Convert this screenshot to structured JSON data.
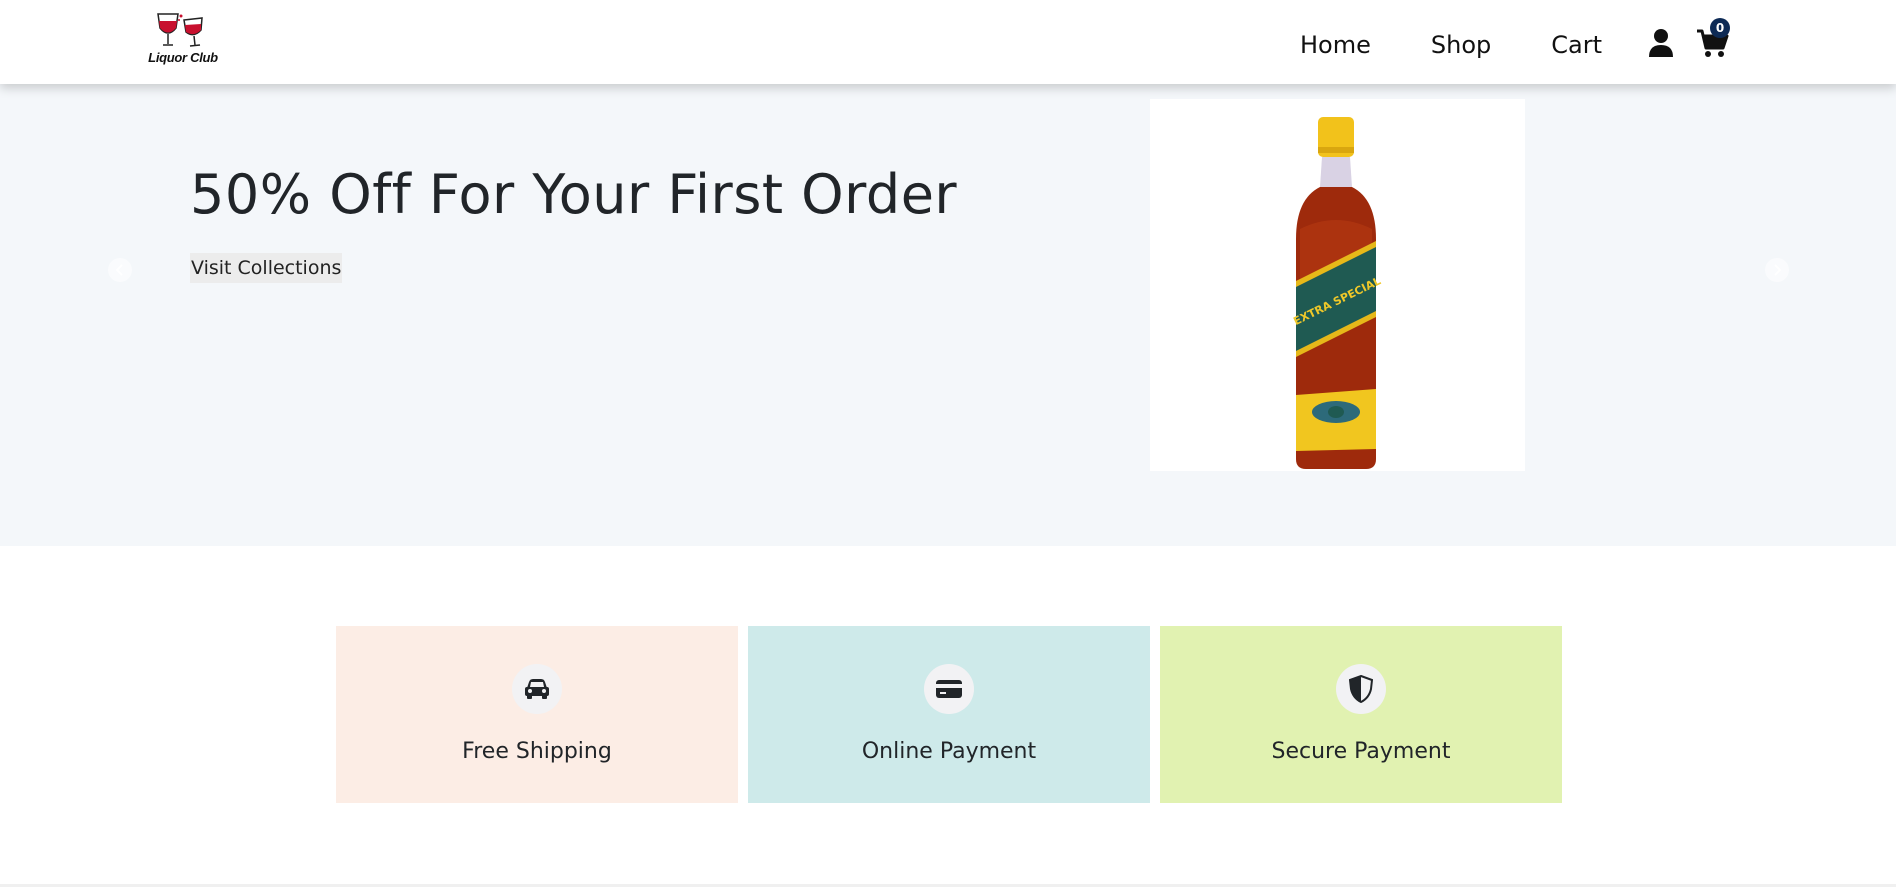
{
  "brand": {
    "name": "Liquor Club"
  },
  "nav": {
    "links": [
      "Home",
      "Shop",
      "Cart"
    ],
    "cart_count": "0"
  },
  "hero": {
    "title": "50% Off For Your First Order",
    "button_label": "Visit Collections",
    "product_label_line1": "EXTRA SPECIAL"
  },
  "features": [
    {
      "label": "Free Shipping",
      "icon": "car-icon",
      "bg": "#fcede5"
    },
    {
      "label": "Online Payment",
      "icon": "credit-card-icon",
      "bg": "#ceeaea"
    },
    {
      "label": "Secure Payment",
      "icon": "shield-icon",
      "bg": "#e1f2b1"
    }
  ],
  "colors": {
    "hero_bg": "#f4f7fa",
    "badge_bg": "#0d2a55"
  }
}
